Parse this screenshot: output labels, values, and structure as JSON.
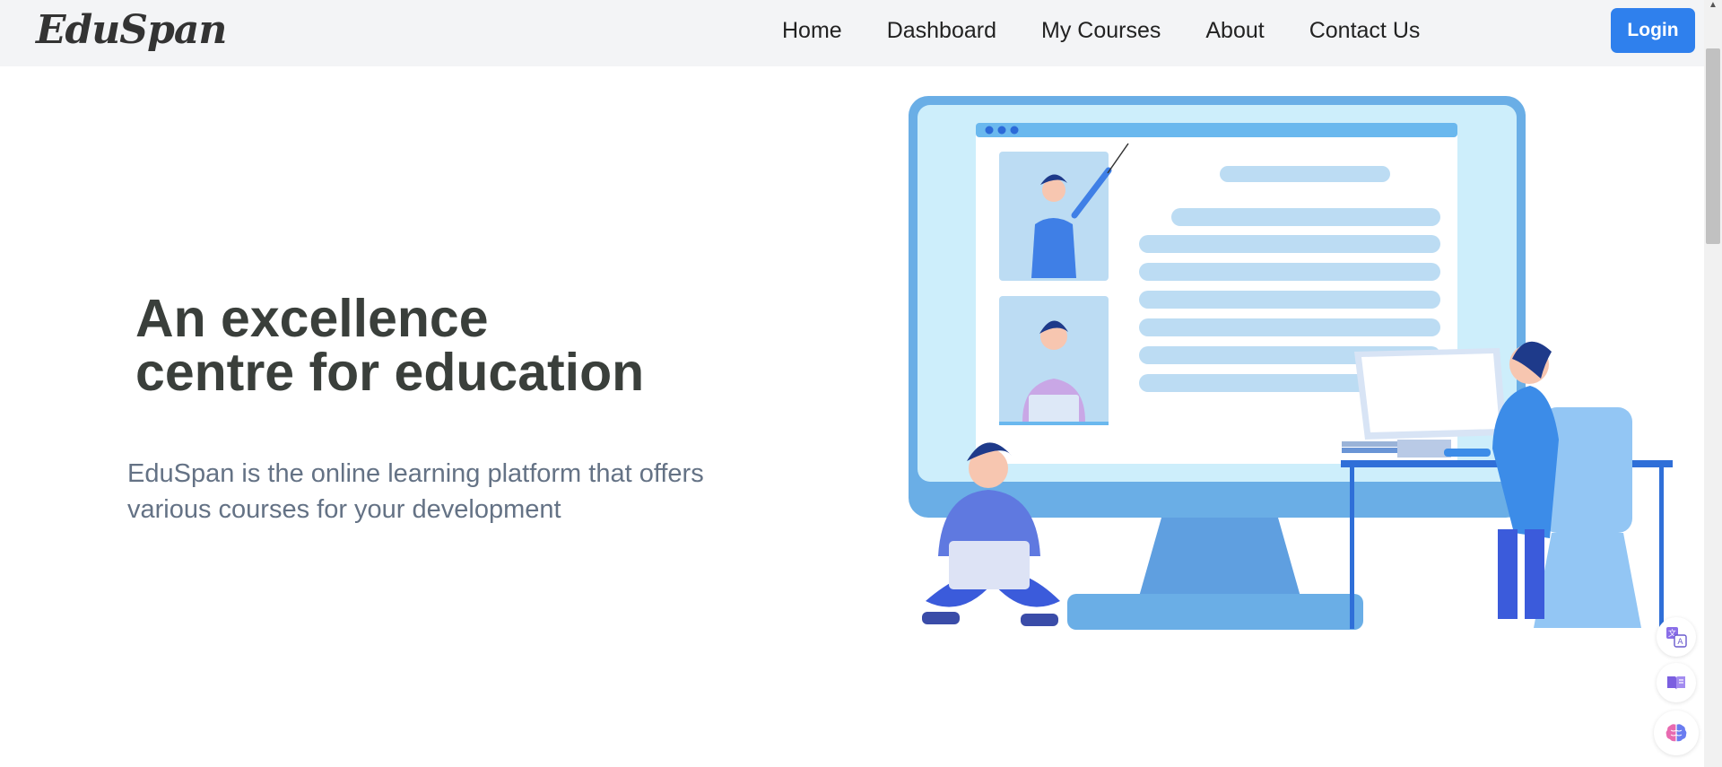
{
  "brand": {
    "name": "EduSpan"
  },
  "nav": {
    "items": [
      {
        "label": "Home"
      },
      {
        "label": "Dashboard"
      },
      {
        "label": "My Courses"
      },
      {
        "label": "About"
      },
      {
        "label": "Contact Us"
      }
    ],
    "login_label": "Login"
  },
  "hero": {
    "title_line1": "An excellence",
    "title_line2": "centre for education",
    "description_line1": "EduSpan is the online learning platform that offers",
    "description_line2": "various courses for your development"
  },
  "side_tools": [
    {
      "icon": "translate-icon"
    },
    {
      "icon": "book-reader-icon"
    },
    {
      "icon": "brain-icon"
    }
  ],
  "colors": {
    "accent": "#2f80ed",
    "heading": "#3a3f3b",
    "body_text": "#647285",
    "navbar_bg": "#f3f4f6"
  }
}
